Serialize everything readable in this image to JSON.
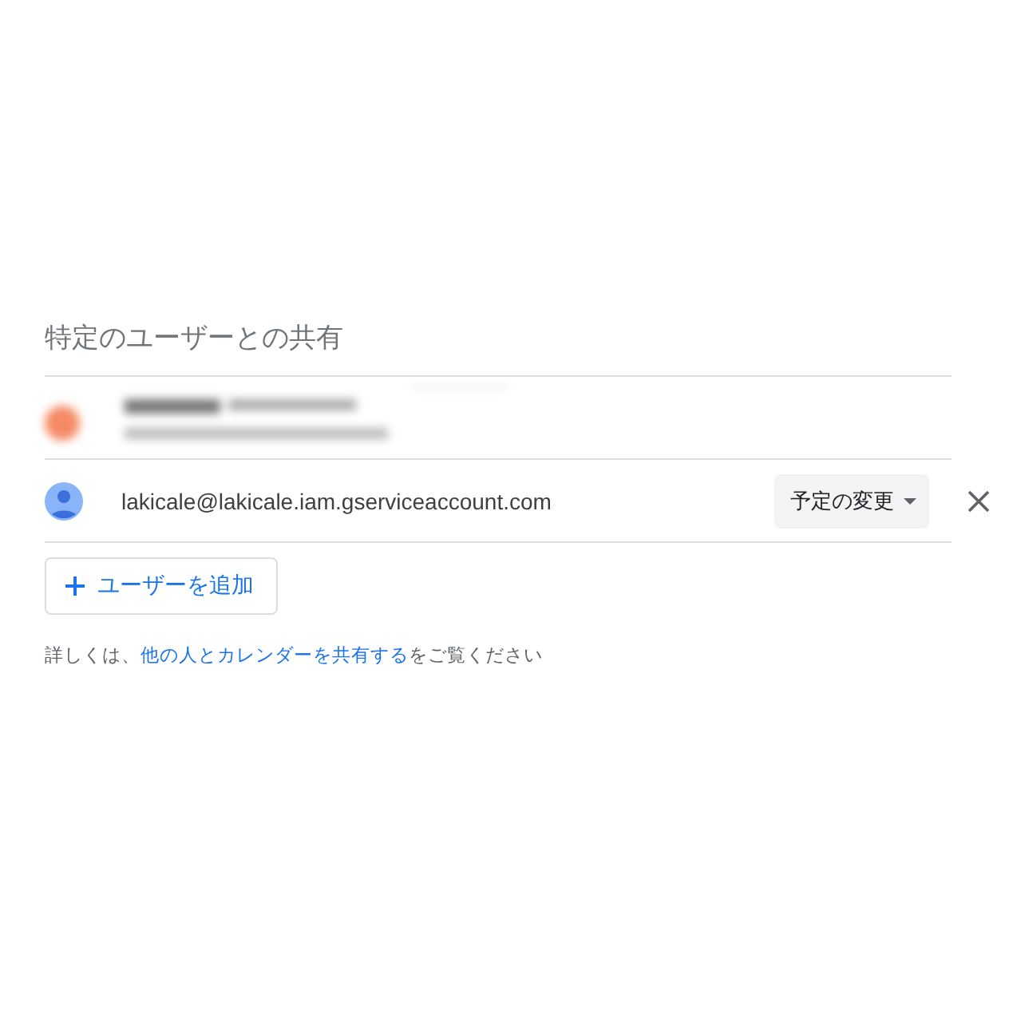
{
  "section_title": "特定のユーザーとの共有",
  "users": [
    {
      "kind": "blurred"
    },
    {
      "kind": "account",
      "email": "lakicale@lakicale.iam.gserviceaccount.com",
      "permission": "予定の変更"
    }
  ],
  "add_button": {
    "label": "ユーザーを追加"
  },
  "help": {
    "before": "詳しくは、",
    "link": "他の人とカレンダーを共有する",
    "after": "をご覧ください"
  }
}
